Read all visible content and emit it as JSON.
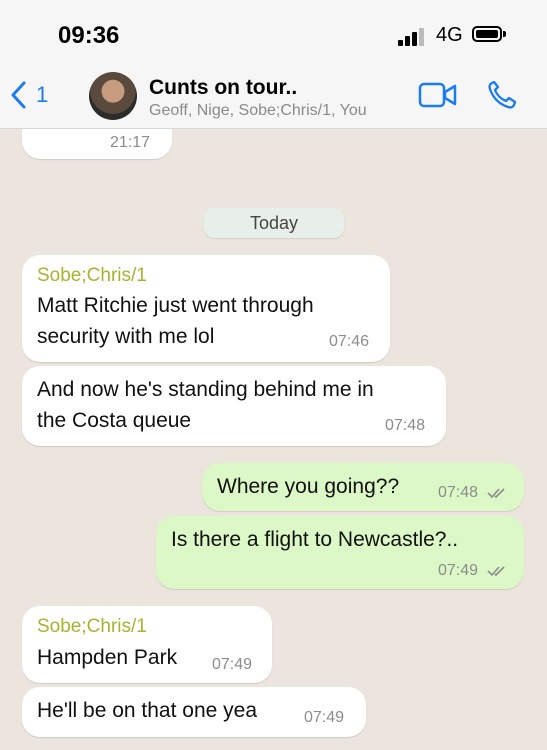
{
  "status_bar": {
    "time": "09:36",
    "network": "4G"
  },
  "header": {
    "back_count": "1",
    "title": "Cunts on tour..",
    "subtitle": "Geoff, Nige, Sobe;Chris/1, You"
  },
  "chat": {
    "top_partial_time": "21:17",
    "day_label": "Today",
    "messages": [
      {
        "sender": "Sobe;Chris/1",
        "line1": "Matt Ritchie just went through",
        "line2": "security with me lol",
        "time": "07:46"
      },
      {
        "line1": "And now he's standing behind me in",
        "line2": "the Costa queue",
        "time": "07:48"
      },
      {
        "text": "Where you going??",
        "time": "07:48"
      },
      {
        "text": "Is there a flight to Newcastle?..",
        "time": "07:49"
      },
      {
        "sender": "Sobe;Chris/1",
        "text": "Hampden Park",
        "time": "07:49"
      },
      {
        "text": "He'll be on that one yea",
        "time": "07:49"
      }
    ]
  },
  "colors": {
    "accent": "#1a7cf3",
    "outgoing": "#dcf8c6",
    "sender": "#a6b42e"
  }
}
